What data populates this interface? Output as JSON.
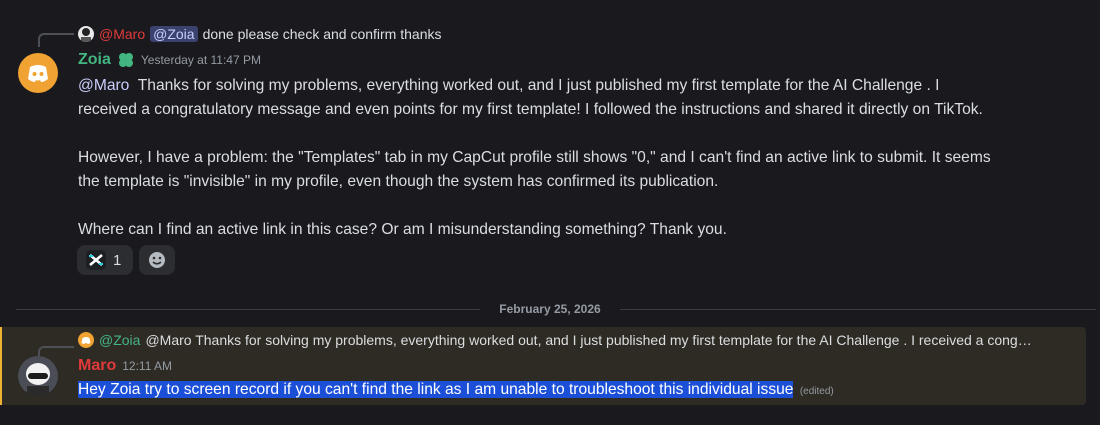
{
  "colors": {
    "zoia_name": "#43b581",
    "maro_name": "#e03a3a",
    "mention": "#c9cdfb",
    "mention_bg": "#3c4270",
    "highlight_border": "#f0b232",
    "selection": "#1c4fd8"
  },
  "message1": {
    "reply": {
      "mention_author": "@Maro",
      "mention_target": "@Zoia",
      "text": "done please check and confirm thanks"
    },
    "author": "Zoia",
    "author_badge_icon": "clover-icon",
    "timestamp": "Yesterday at 11:47 PM",
    "mention": "@Maro",
    "line1": "Thanks for solving my problems, everything worked out, and I just published my first template for the AI Challenge . I",
    "line2": "received a congratulatory message and even points for my first template!  I followed the instructions and shared it directly on TikTok.",
    "para2_line1": "However, I have a problem: the \"Templates\" tab in my CapCut profile still shows \"0,\" and I can't find an active link to submit. It seems",
    "para2_line2": "the template is \"invisible\" in my profile, even though the system has confirmed its publication.",
    "para3": "Where can I find an active link in this case? Or am I misunderstanding something? Thank you.",
    "reactions": [
      {
        "icon": "capcut-icon",
        "count": "1"
      }
    ],
    "add_reaction_icon": "smiley-icon"
  },
  "date_divider": "February 25, 2026",
  "message2": {
    "reply": {
      "mention_author": "@Zoia",
      "text": "@Maro  Thanks for solving my problems, everything worked out, and I just published my first template for the AI Challenge . I received a cong…"
    },
    "author": "Maro",
    "timestamp": "12:11 AM",
    "text": "Hey Zoia try to screen record if you can't find the link as I am unable to troubleshoot this individual issue",
    "edited": "(edited)"
  }
}
